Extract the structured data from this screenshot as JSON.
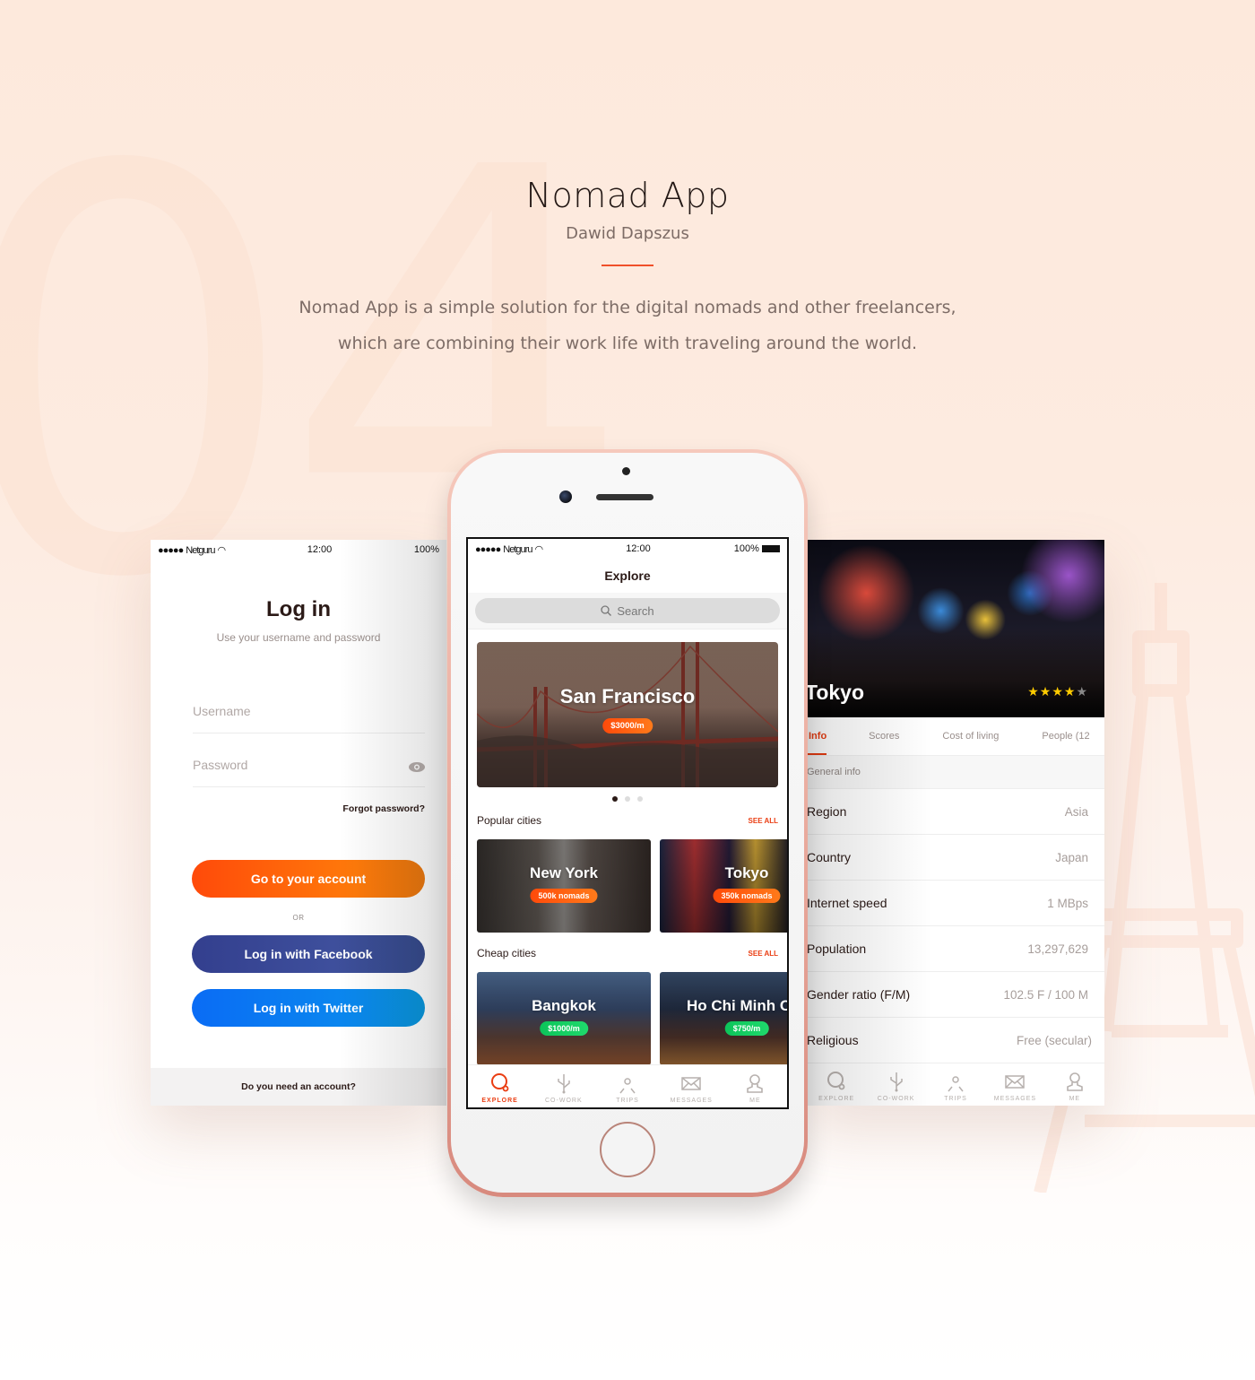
{
  "background": {
    "numeral": "04"
  },
  "hero": {
    "title": "Nomad App",
    "author": "Dawid Dapszus",
    "description_line1": "Nomad App is a simple solution for the digital nomads and other freelancers,",
    "description_line2": "which are combining their work life with traveling around the world.",
    "accent_color": "#f0502a"
  },
  "status_bar": {
    "carrier": "Netguru",
    "time": "12:00",
    "battery": "100%"
  },
  "login": {
    "title": "Log in",
    "subtitle": "Use your username and password",
    "username_placeholder": "Username",
    "password_placeholder": "Password",
    "forgot": "Forgot password?",
    "primary_button": "Go to your account",
    "or": "OR",
    "facebook_button": "Log in with Facebook",
    "twitter_button": "Log in with Twitter",
    "footer": "Do you need an account?"
  },
  "explore": {
    "title": "Explore",
    "search_placeholder": "Search",
    "featured": {
      "city": "San Francisco",
      "price": "$3000/m"
    },
    "carousel": {
      "pages": 3,
      "active": 1
    },
    "popular": {
      "title": "Popular cities",
      "see_all": "SEE ALL",
      "cities": [
        {
          "name": "New York",
          "badge": "500k nomads"
        },
        {
          "name": "Tokyo",
          "badge": "350k nomads"
        }
      ]
    },
    "cheap": {
      "title": "Cheap cities",
      "see_all": "SEE ALL",
      "cities": [
        {
          "name": "Bangkok",
          "badge": "$1000/m"
        },
        {
          "name": "Ho Chi Minh City",
          "badge": "$750/m"
        }
      ]
    }
  },
  "tabbar": {
    "items": [
      {
        "label": "EXPLORE",
        "icon": "explore-icon"
      },
      {
        "label": "CO-WORK",
        "icon": "usb-icon"
      },
      {
        "label": "TRIPS",
        "icon": "map-pin-icon"
      },
      {
        "label": "MESSAGES",
        "icon": "envelope-icon"
      },
      {
        "label": "ME",
        "icon": "user-icon"
      }
    ],
    "active_color": "#ea3d12"
  },
  "city_detail": {
    "name": "Tokyo",
    "rating": 4,
    "rating_max": 5,
    "tabs": [
      "Info",
      "Scores",
      "Cost of living",
      "People (12"
    ],
    "active_tab": 0,
    "group": "General info",
    "rows": [
      {
        "label": "Region",
        "value": "Asia"
      },
      {
        "label": "Country",
        "value": "Japan"
      },
      {
        "label": "Internet speed",
        "value": "1 MBps"
      },
      {
        "label": "Population",
        "value": "13,297,629"
      },
      {
        "label": "Gender ratio (F/M)",
        "value": "102.5 F / 100 M"
      },
      {
        "label": "Religious",
        "value": "Free (secular)"
      }
    ]
  }
}
